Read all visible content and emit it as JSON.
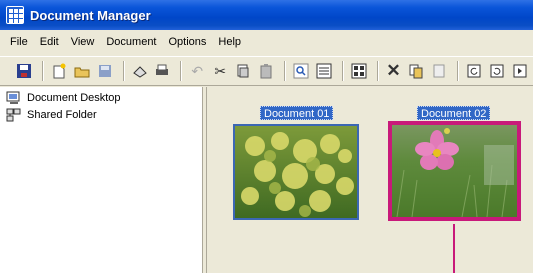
{
  "window": {
    "title": "Document Manager",
    "icon": "app-grid-icon"
  },
  "menu": [
    "File",
    "Edit",
    "View",
    "Document",
    "Options",
    "Help"
  ],
  "toolbar": [
    "save-icon",
    "sep",
    "new-icon",
    "open-icon",
    "disk-icon",
    "sep",
    "scan-icon",
    "print-icon",
    "sep",
    "undo-icon",
    "cut-icon",
    "copy-icon",
    "paste-icon",
    "sep",
    "zoom-icon",
    "list-view-icon",
    "sep",
    "thumbnail-view-icon",
    "sep",
    "delete-icon",
    "copy-doc-icon",
    "properties-icon",
    "sep",
    "rotate-left-icon",
    "rotate-right-icon",
    "next-icon"
  ],
  "tree": {
    "items": [
      {
        "label": "Document Desktop",
        "icon": "desktop-icon"
      },
      {
        "label": "Shared Folder",
        "icon": "shared-folder-icon"
      }
    ]
  },
  "documents": [
    {
      "label": "Document 01",
      "selected": false,
      "thumb": "yellow-flowers"
    },
    {
      "label": "Document 02",
      "selected": true,
      "thumb": "pink-cosmos-flower"
    }
  ],
  "colors": {
    "title_bar": "#0a4ec5",
    "selection_label": "#3167c6",
    "highlight_frame": "#c8197a",
    "desktop": "#ece9d8"
  }
}
